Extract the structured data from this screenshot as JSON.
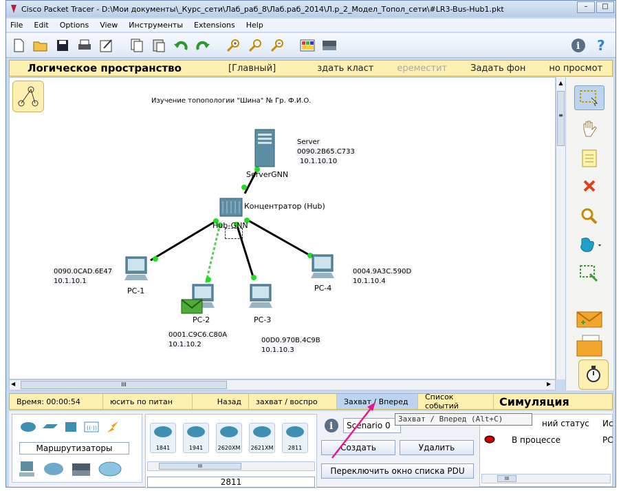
{
  "window": {
    "title": "Cisco Packet Tracer - D:\\Мои документы\\_Курс_сети\\Лаб_раб_8\\Лаб.раб_2014\\Л.р_2_Модел_Топол_сети\\#LR3-Bus-Hub1.pkt",
    "controls": {
      "minimize": "–",
      "maximize": "□"
    }
  },
  "menu": [
    "File",
    "Edit",
    "Options",
    "View",
    "Инструменты",
    "Extensions",
    "Help"
  ],
  "toolbar": {
    "icons": [
      "new-file-icon",
      "open-folder-icon",
      "save-icon",
      "print-icon",
      "activity-wizard-icon",
      "copy-icon",
      "paste-icon",
      "undo-icon",
      "redo-icon",
      "zoom-in-icon",
      "zoom-reset-icon",
      "zoom-out-icon",
      "palette-icon",
      "custom-device-icon"
    ],
    "right": [
      "info-icon",
      "help-icon"
    ]
  },
  "workspace_bar": {
    "title": "Логическое пространство",
    "items": [
      {
        "label": "[Главный]",
        "dim": false
      },
      {
        "label": "здать класт",
        "dim": false
      },
      {
        "label": "ереместит",
        "dim": true
      },
      {
        "label": "Задать фон",
        "dim": false
      },
      {
        "label": "но просмот",
        "dim": false
      }
    ]
  },
  "canvas": {
    "heading": "Изучение топопологии \"Шина\" № Гр. Ф.И.О.",
    "devices": {
      "server": {
        "name": "ServerGNN",
        "mac": "0090.2B65.C733",
        "ip": "10.1.10.10",
        "type_label": "Server"
      },
      "hub": {
        "name": "Hub-GNN",
        "caption": "Концентратор (Hub)"
      },
      "pc1": {
        "name": "PC-1",
        "mac": "0090.0CAD.6E47",
        "ip": "10.1.10.1"
      },
      "pc2": {
        "name": "PC-2",
        "mac": "0001.C9C6.C80A",
        "ip": "10.1.10.2"
      },
      "pc3": {
        "name": "PC-3",
        "mac": "00D0.970B.4C9B",
        "ip": "10.1.10.3"
      },
      "pc4": {
        "name": "PC-4",
        "mac": "0004.9A3C.590D",
        "ip": "10.1.10.4"
      }
    },
    "hscroll_grip": "III",
    "vscroll_grip": "≡"
  },
  "status_bar": {
    "time": "Время: 00:00:54",
    "power": "юсить по питан",
    "back": "Назад",
    "capture_play": "захват / воспро",
    "capture_forward": "Захват / Вперед",
    "event_list": "Список событий",
    "mode": "Симуляция"
  },
  "tooltip": "Захват / Вперед (Alt+C)",
  "device_panel": {
    "category_label": "Маршрутизаторы",
    "models": [
      "1841",
      "1941",
      "2620XM",
      "2621XM",
      "2811"
    ],
    "selected_model": "2811"
  },
  "scenario": {
    "label": "Scenario 0",
    "create": "Создать",
    "delete": "Удалить",
    "toggle_list": "Переключить окно списка PDU"
  },
  "pdu_table": {
    "header": "ний статус",
    "header2": "Ис",
    "row_status": "В процессе",
    "row_src": "PC"
  },
  "colors": {
    "workspace_bar": "#fdf0b0",
    "link": "#000000",
    "link_port": "#22dd22",
    "arrow": "#e8158c"
  }
}
